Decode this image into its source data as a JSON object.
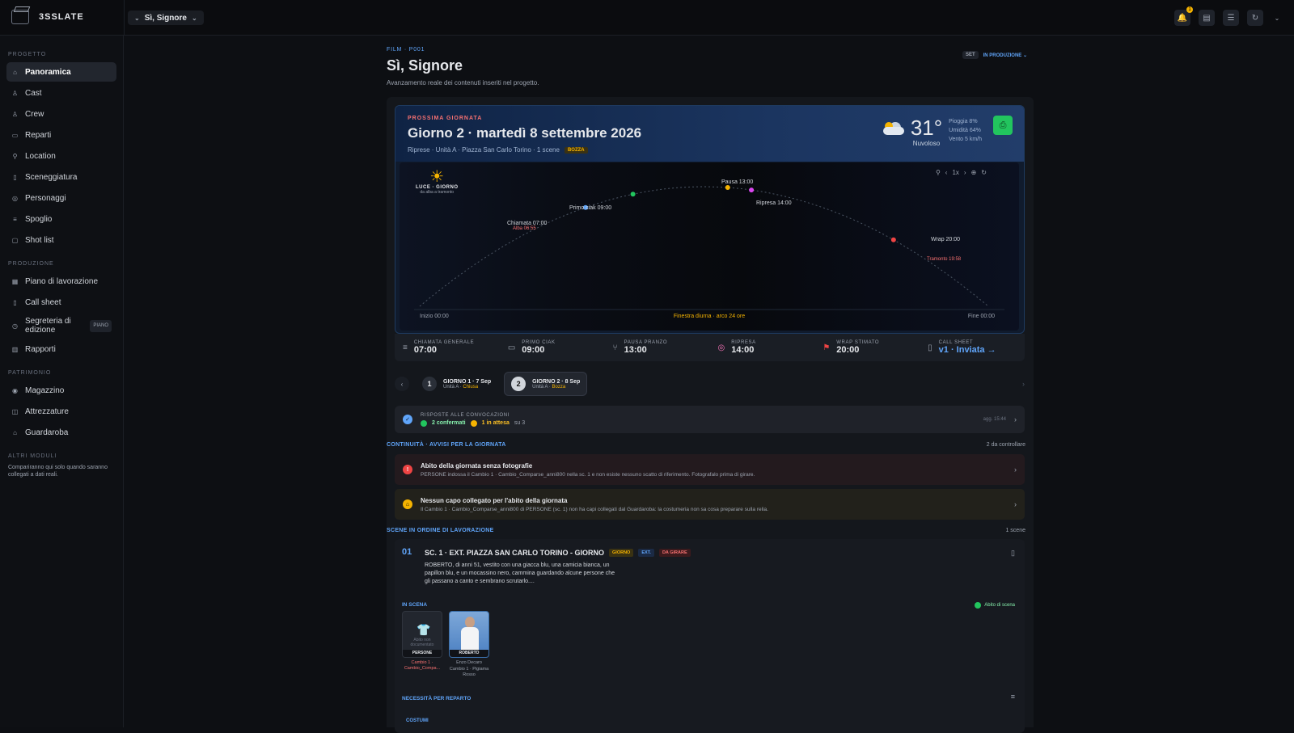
{
  "app": {
    "brand": "3SSLATE",
    "project_select": "Sì, Signore"
  },
  "topbar": {
    "notification_count": "1"
  },
  "sidebar": {
    "section_project": "PROGETTO",
    "project_items": [
      {
        "label": "Panoramica",
        "icon": "grid-icon"
      },
      {
        "label": "Cast",
        "icon": "people-icon"
      },
      {
        "label": "Crew",
        "icon": "people-icon"
      },
      {
        "label": "Reparti",
        "icon": "sliders-icon"
      },
      {
        "label": "Location",
        "icon": "pin-icon"
      },
      {
        "label": "Sceneggiatura",
        "icon": "document-icon"
      },
      {
        "label": "Personaggi",
        "icon": "person-icon"
      },
      {
        "label": "Spoglio",
        "icon": "list-icon"
      },
      {
        "label": "Shot list",
        "icon": "camera-icon"
      }
    ],
    "section_production": "PRODUZIONE",
    "production_items": [
      {
        "label": "Piano di lavorazione",
        "icon": "calendar-icon"
      },
      {
        "label": "Call sheet",
        "icon": "sheet-icon"
      },
      {
        "label": "Segreteria di edizione",
        "badge": "PIANO",
        "icon": "clock-icon"
      },
      {
        "label": "Rapporti",
        "icon": "chart-icon"
      }
    ],
    "section_assets": "PATRIMONIO",
    "asset_items": [
      {
        "label": "Magazzino",
        "icon": "box-icon"
      },
      {
        "label": "Attrezzature",
        "icon": "tool-icon"
      },
      {
        "label": "Guardaroba",
        "icon": "hanger-icon"
      }
    ],
    "section_other": "ALTRI MODULI",
    "other_note": "Compariranno qui solo quando saranno collegati a dati reali."
  },
  "header": {
    "breadcrumb": "FILM · P001",
    "title": "Sì, Signore",
    "subtitle": "Avanzamento reale dei contenuti inseriti nel progetto.",
    "set_badge": "SET",
    "status": "IN PRODUZIONE ⌄"
  },
  "next_day": {
    "label": "PROSSIMA GIORNATA",
    "title": "Giorno 2 · martedì 8 settembre 2026",
    "subtitle": "Riprese · Unità A · Piazza San Carlo Torino · 1 scene",
    "draft_badge": "BOZZA",
    "weather": {
      "temp": "31°",
      "condition": "Nuvoloso",
      "rain": "Pioggia 8%",
      "humidity": "Umidità 64%",
      "wind": "Vento 5 km/h"
    }
  },
  "timeline": {
    "daylight_label": "LUCE · GIORNO",
    "daylight_sub": "da alba a tramonto",
    "zoom": "1x",
    "events": [
      {
        "label": "Chiamata 07:00",
        "sub": "Alba 06:55",
        "hour": 7,
        "color": "#60a5fa"
      },
      {
        "label": "Primo ciak 09:00",
        "hour": 9,
        "color": "#22c55e"
      },
      {
        "label": "Pausa 13:00",
        "hour": 13,
        "color": "#f5b301"
      },
      {
        "label": "Ripresa 14:00",
        "hour": 14,
        "color": "#d946ef"
      },
      {
        "label": "Wrap 20:00",
        "sub": "Tramonto 19:58",
        "hour": 20,
        "color": "#ef4444"
      }
    ],
    "start": "Inizio 00:00",
    "window": "Finestra diurna · arco 24 ore",
    "end": "Fine 00:00"
  },
  "stats": [
    {
      "label": "CHIAMATA GENERALE",
      "value": "07:00",
      "icon": "list-icon"
    },
    {
      "label": "PRIMO CIAK",
      "value": "09:00",
      "icon": "clapper-icon"
    },
    {
      "label": "PAUSA PRANZO",
      "value": "13:00",
      "icon": "cutlery-icon"
    },
    {
      "label": "RIPRESA",
      "value": "14:00",
      "icon": "target-icon"
    },
    {
      "label": "WRAP STIMATO",
      "value": "20:00",
      "icon": "flag-icon"
    },
    {
      "label": "CALL SHEET",
      "value": "v1 · Inviata →",
      "icon": "sheet-icon"
    }
  ],
  "days": [
    {
      "num": "1",
      "title": "GIORNO 1 · 7 Sep",
      "sub_a": "Unità A · ",
      "sub_b": "Chiusa"
    },
    {
      "num": "2",
      "title": "GIORNO 2 · 8 Sep",
      "sub_a": "Unità A · ",
      "sub_b": "Bozza"
    }
  ],
  "responses": {
    "title": "RISPOSTE ALLE CONVOCAZIONI",
    "confirmed": "2 confermati",
    "pending": "1 in attesa",
    "total": "su 3",
    "updated": "agg. 15:44"
  },
  "continuity": {
    "title": "CONTINUITÀ · AVVISI PER LA GIORNATA",
    "count": "2 da controllare"
  },
  "alerts": [
    {
      "title": "Abito della giornata senza fotografie",
      "desc": "PERSONE indossa il Cambio 1 · Cambio_Comparse_anni800 nella sc. 1 e non esiste nessuno scatto di riferimento. Fotografalo prima di girare."
    },
    {
      "title": "Nessun capo collegato per l'abito della giornata",
      "desc": "Il Cambio 1 · Cambio_Comparse_anni800 di PERSONE (sc. 1) non ha capi collegati dal Guardaroba: la costumeria non sa cosa preparare sulla relia."
    }
  ],
  "scenes": {
    "title": "SCENE IN ORDINE DI LAVORAZIONE",
    "count": "1 scene",
    "items": [
      {
        "num": "01",
        "title": "SC. 1 · EXT. PIAZZA SAN CARLO TORINO - GIORNO",
        "tags": [
          "GIORNO",
          "EXT.",
          "DA GIRARE"
        ],
        "desc": "ROBERTO, di anni 51, vestito con una giacca blu, una camicia bianca, un papillon blu, e un mocassino nero, cammina guardando alcune persone che gli passano a canto e sembrano scrutarlo...."
      }
    ],
    "in_scene": "IN SCENA",
    "costume_status": "Abito di scena",
    "cast": [
      {
        "role": "PERSONE",
        "note": "Abito non documentato",
        "caption": "Cambio 1 · Cambio_Compa..."
      },
      {
        "role": "ROBERTO",
        "actor": "Enzo Decaro",
        "caption": "Cambio 1 · Pigiama Rosso"
      }
    ],
    "needs": "NECESSITÀ PER REPARTO",
    "dept": "COSTUMI"
  }
}
